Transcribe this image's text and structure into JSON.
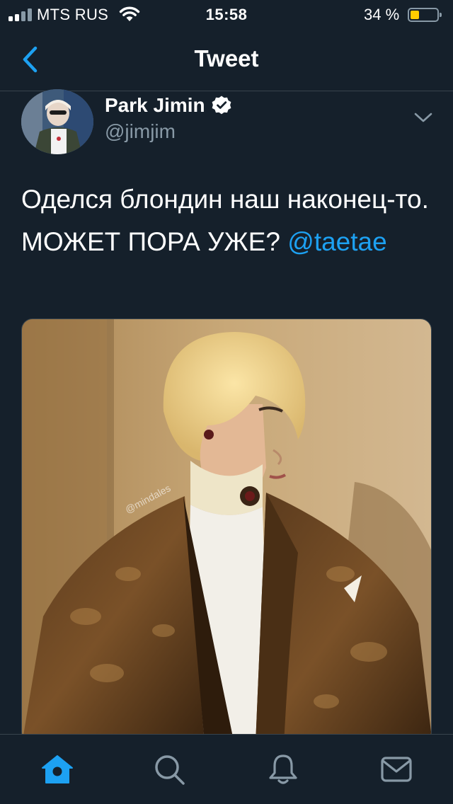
{
  "status_bar": {
    "carrier": "MTS RUS",
    "time": "15:58",
    "battery_percent_label": "34 %",
    "battery_level": 0.34,
    "battery_color": "#ffcc00"
  },
  "nav": {
    "title": "Tweet",
    "back_icon": "chevron-left-icon"
  },
  "tweet": {
    "user_name": "Park Jimin",
    "verified": true,
    "handle": "@jimjim",
    "text": "Оделся блондин наш наконец-то. МОЖЕТ ПОРА УЖЕ? ",
    "mention": "@taetae",
    "media_watermark": "@mindales"
  },
  "tab_bar": {
    "tabs": [
      {
        "icon": "home-icon",
        "active": true
      },
      {
        "icon": "search-icon",
        "active": false
      },
      {
        "icon": "bell-icon",
        "active": false
      },
      {
        "icon": "mail-icon",
        "active": false
      }
    ]
  },
  "colors": {
    "background": "#15202b",
    "accent": "#1da1f2",
    "secondary_text": "#8899a6",
    "divider": "#38444d"
  }
}
